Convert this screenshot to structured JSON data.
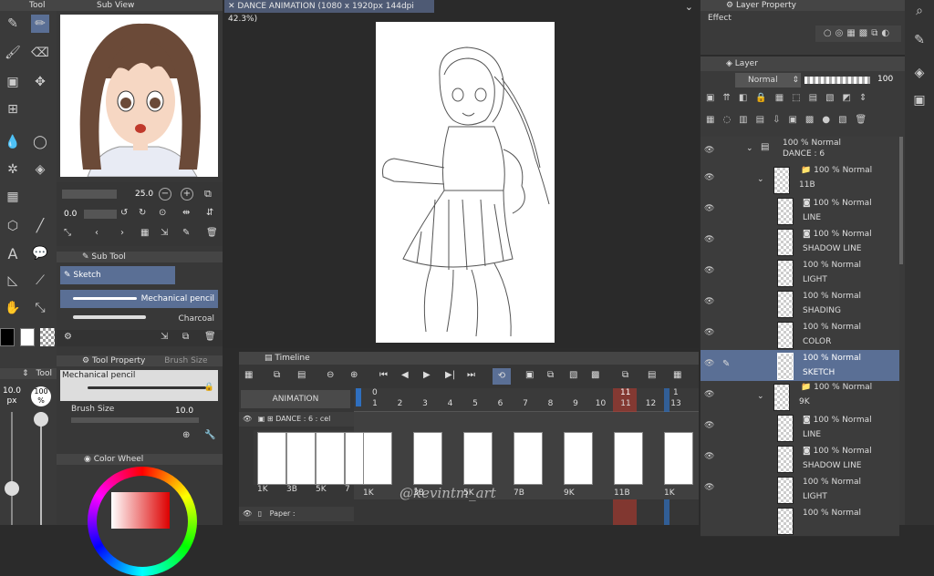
{
  "tool_panel": {
    "title": "Tool"
  },
  "sub_view": {
    "title": "Sub View"
  },
  "canvas_tab": {
    "title": "DANCE ANIMATION (1080 x 1920px 144dpi 42.3%)"
  },
  "nav": {
    "zoom": "25.0",
    "rotation": "0.0"
  },
  "sub_tool": {
    "title": "Sub Tool",
    "group": "Sketch",
    "items": [
      "Mechanical pencil",
      "Charcoal"
    ]
  },
  "tool_property": {
    "title": "Tool Property",
    "tab2": "Brush Size",
    "tool_name": "Mechanical pencil",
    "brush_size_label": "Brush Size",
    "brush_size_value": "10.0"
  },
  "brush_slider": {
    "size": "10.0",
    "size_unit": "px",
    "opacity": "100",
    "opacity_unit": "%"
  },
  "color_wheel": {
    "title": "Color Wheel"
  },
  "layer_property": {
    "title": "Layer Property",
    "effect": "Effect"
  },
  "layer_panel": {
    "title": "Layer",
    "blend_mode": "Normal",
    "opacity": "100",
    "layers": [
      {
        "opacity": "100 %",
        "mode": "Normal",
        "name": "DANCE : 6",
        "type": "anim"
      },
      {
        "opacity": "100 %",
        "mode": "Normal",
        "name": "11B",
        "type": "folder"
      },
      {
        "opacity": "100 %",
        "mode": "Normal",
        "name": "LINE",
        "type": "vector"
      },
      {
        "opacity": "100 %",
        "mode": "Normal",
        "name": "SHADOW LINE",
        "type": "vector"
      },
      {
        "opacity": "100 %",
        "mode": "Normal",
        "name": "LIGHT",
        "type": "raster"
      },
      {
        "opacity": "100 %",
        "mode": "Normal",
        "name": "SHADING",
        "type": "raster"
      },
      {
        "opacity": "100 %",
        "mode": "Normal",
        "name": "COLOR",
        "type": "raster"
      },
      {
        "opacity": "100 %",
        "mode": "Normal",
        "name": "SKETCH",
        "type": "raster",
        "selected": true
      },
      {
        "opacity": "100 %",
        "mode": "Normal",
        "name": "9K",
        "type": "folder"
      },
      {
        "opacity": "100 %",
        "mode": "Normal",
        "name": "LINE",
        "type": "vector"
      },
      {
        "opacity": "100 %",
        "mode": "Normal",
        "name": "SHADOW LINE",
        "type": "vector"
      },
      {
        "opacity": "100 %",
        "mode": "Normal",
        "name": "LIGHT",
        "type": "raster"
      },
      {
        "opacity": "100 %",
        "mode": "Normal",
        "name": "",
        "type": "raster"
      }
    ]
  },
  "timeline": {
    "title": "Timeline",
    "name": "ANIMATION",
    "playhead": "0",
    "frame_numbers": [
      "1",
      "2",
      "3",
      "4",
      "5",
      "6",
      "7",
      "8",
      "9",
      "10",
      "11",
      "12",
      "13"
    ],
    "marker_11": "11",
    "marker_13": "1",
    "tracks": {
      "dance": "DANCE : 6 : cel",
      "paper": "Paper :"
    },
    "cel_labels_left": [
      "1K",
      "3B",
      "5K",
      "7"
    ],
    "cel_labels_right": [
      "1K",
      "3B",
      "5K",
      "7B",
      "9K",
      "11B",
      "1K"
    ]
  },
  "watermark": "@kevintm_art",
  "colors": {
    "accent": "#5a6f95",
    "marker_red": "#c0392b",
    "marker_blue": "#2f6fbf"
  }
}
